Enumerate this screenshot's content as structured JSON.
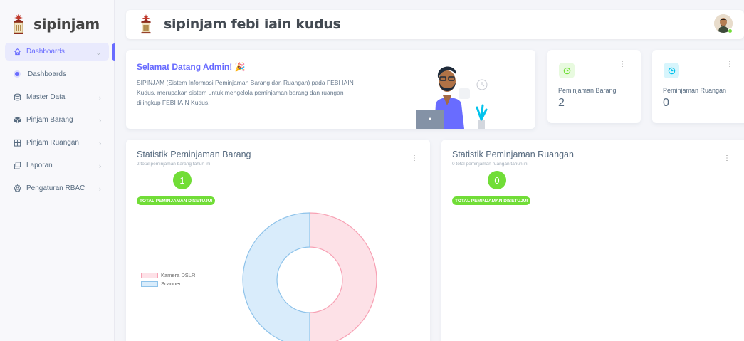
{
  "sidebar": {
    "brand": "sipinjam",
    "items": [
      {
        "label": "Dashboards",
        "icon": "home-icon"
      },
      {
        "label": "Dashboards",
        "icon": "dot-icon"
      },
      {
        "label": "Master Data",
        "icon": "database-icon"
      },
      {
        "label": "Pinjam Barang",
        "icon": "box-icon"
      },
      {
        "label": "Pinjam Ruangan",
        "icon": "building-icon"
      },
      {
        "label": "Laporan",
        "icon": "copy-icon"
      },
      {
        "label": "Pengaturan RBAC",
        "icon": "gear-icon"
      }
    ]
  },
  "topbar": {
    "title": "sipinjam febi iain kudus"
  },
  "welcome": {
    "title": "Selamat Datang Admin! 🎉",
    "body": "SIPINJAM (Sistem Informasi Peminjaman Barang dan Ruangan) pada FEBI IAIN Kudus, merupakan sistem untuk mengelola peminjaman barang dan ruangan dilingkup FEBI IAIN Kudus."
  },
  "stats": [
    {
      "label": "Peminjaman Barang",
      "value": "2",
      "icon_color": "#71dd37",
      "icon_bg": "#e8fadf"
    },
    {
      "label": "Peminjaman Ruangan",
      "value": "0",
      "icon_color": "#03c3ec",
      "icon_bg": "#d7f5fc"
    }
  ],
  "charts": [
    {
      "title": "Statistik Peminjaman Barang",
      "subtitle": "2 total peminjaman barang tahun ini",
      "count": "1",
      "badge": "TOTAL PEMINJAMAN DISETUJUI"
    },
    {
      "title": "Statistik Peminjaman Ruangan",
      "subtitle": "0 total peminjaman ruangan tahun ini",
      "count": "0",
      "badge": "TOTAL PEMINJAMAN DISETUJUI"
    }
  ],
  "chart_data": {
    "type": "pie",
    "categories": [
      "Kamera DSLR",
      "Scanner"
    ],
    "values": [
      1,
      1
    ],
    "colors": [
      "#fde1e7",
      "#d9ecfb"
    ],
    "borders": [
      "#f7a1b4",
      "#8fc3ea"
    ],
    "legend": "left"
  },
  "colors": {
    "accent": "#696cff",
    "success": "#71dd37",
    "info": "#03c3ec"
  }
}
